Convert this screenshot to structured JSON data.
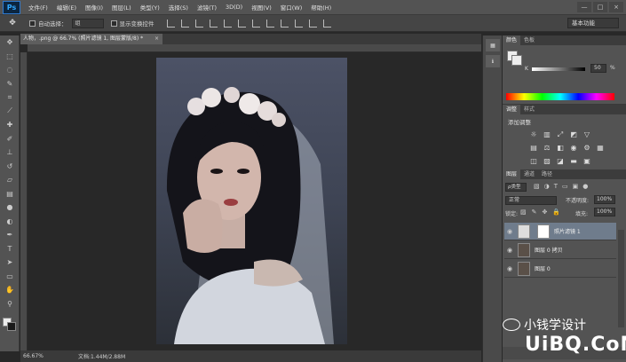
{
  "app": {
    "logo": "Ps"
  },
  "menu": [
    "文件(F)",
    "编辑(E)",
    "图像(I)",
    "图层(L)",
    "类型(Y)",
    "选择(S)",
    "滤镜(T)",
    "3D(D)",
    "视图(V)",
    "窗口(W)",
    "帮助(H)"
  ],
  "window_controls": [
    "—",
    "□",
    "×"
  ],
  "options": {
    "auto_select_label": "自动选择：",
    "auto_select_value": "组",
    "transform_label": "显示变换控件",
    "workspace": "基本功能"
  },
  "document": {
    "tab_title": "人物，.png @ 66.7% (照片滤镜 1, 图层蒙版/8) *",
    "zoom": "66.67%",
    "doc_info": "文档:1.44M/2.88M"
  },
  "colors": {
    "tabs": [
      "颜色",
      "色板"
    ],
    "k_label": "K",
    "k_value": "50",
    "k_unit": "%"
  },
  "adjustments": {
    "tabs": [
      "调整",
      "样式"
    ],
    "title": "添加调整"
  },
  "layers": {
    "tabs": [
      "图层",
      "通道",
      "路径"
    ],
    "filter_kind": "ρ类型",
    "blend_mode": "正常",
    "opacity_label": "不透明度:",
    "opacity_value": "100%",
    "lock_label": "锁定:",
    "fill_label": "填充:",
    "fill_value": "100%",
    "items": [
      {
        "name": "照片滤镜 1"
      },
      {
        "name": "图层 0 拷贝"
      },
      {
        "name": "图层 0"
      }
    ]
  },
  "watermark": {
    "text": "小钱学设计",
    "site": "UiBQ.CoM"
  }
}
